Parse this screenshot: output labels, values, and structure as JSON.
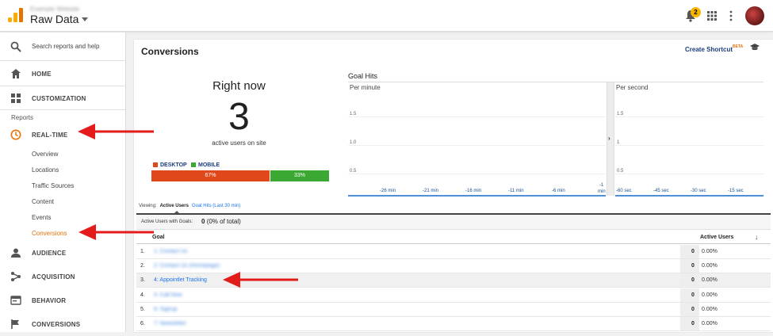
{
  "topbar": {
    "account_sub": "Example Website",
    "account_title": "Raw Data",
    "notification_count": "2"
  },
  "sidebar": {
    "search_label": "Search reports and help",
    "home": "HOME",
    "customization": "CUSTOMIZATION",
    "reports_section": "Reports",
    "realtime": "REAL-TIME",
    "realtime_items": [
      "Overview",
      "Locations",
      "Traffic Sources",
      "Content",
      "Events",
      "Conversions"
    ],
    "audience": "AUDIENCE",
    "acquisition": "ACQUISITION",
    "behavior": "BEHAVIOR",
    "conversions": "CONVERSIONS"
  },
  "main": {
    "title": "Conversions",
    "create_shortcut": "Create Shortcut",
    "beta": "BETA",
    "right_now_title": "Right now",
    "right_now_count": "3",
    "right_now_caption": "active users on site",
    "devices": {
      "desktop_label": "DESKTOP",
      "mobile_label": "MOBILE",
      "desktop_pct": "67%",
      "mobile_pct": "33%",
      "desktop_share": 0.67,
      "mobile_share": 0.33
    },
    "goal_hits": {
      "title": "Goal Hits",
      "per_minute": "Per minute",
      "per_second": "Per second",
      "y_ticks_left": [
        "1.5",
        "1.0",
        "0.5"
      ],
      "y_ticks_right": [
        "1.5",
        "1",
        "0.5"
      ],
      "x_ticks_left": [
        "-26 min",
        "-21 min",
        "-16 min",
        "-11 min",
        "-6 min",
        "-1"
      ],
      "x_tick_left_wrap": "min",
      "x_ticks_right": [
        "-60 sec",
        "-45 sec",
        "-30 sec",
        "-15 sec"
      ]
    },
    "viewing": {
      "label": "Viewing:",
      "active_tab": "Active Users",
      "other_tab": "Goal Hits (Last 30 min)"
    },
    "active_with_goals": {
      "label": "Active Users with Goals:",
      "value": "0",
      "suffix": "(0% of total)"
    },
    "table": {
      "col_goal": "Goal",
      "col_active": "Active Users",
      "rows": [
        {
          "idx": "1.",
          "goal": "1: Contact Us",
          "value": "0",
          "pct": "0.00%"
        },
        {
          "idx": "2.",
          "goal": "2: Contact Us (Homepage)",
          "value": "0",
          "pct": "0.00%"
        },
        {
          "idx": "3.",
          "goal": "4: Appointlet Tracking",
          "value": "0",
          "pct": "0.00%"
        },
        {
          "idx": "4.",
          "goal": "5: Call Now",
          "value": "0",
          "pct": "0.00%"
        },
        {
          "idx": "5.",
          "goal": "6: Signup",
          "value": "0",
          "pct": "0.00%"
        },
        {
          "idx": "6.",
          "goal": "7: Newsletter",
          "value": "0",
          "pct": "0.00%"
        }
      ]
    }
  },
  "colors": {
    "accent_orange": "#e8710a",
    "desktop": "#e0481c",
    "mobile": "#3aa832",
    "arrow": "#e31b1b",
    "link": "#1a73e8"
  }
}
